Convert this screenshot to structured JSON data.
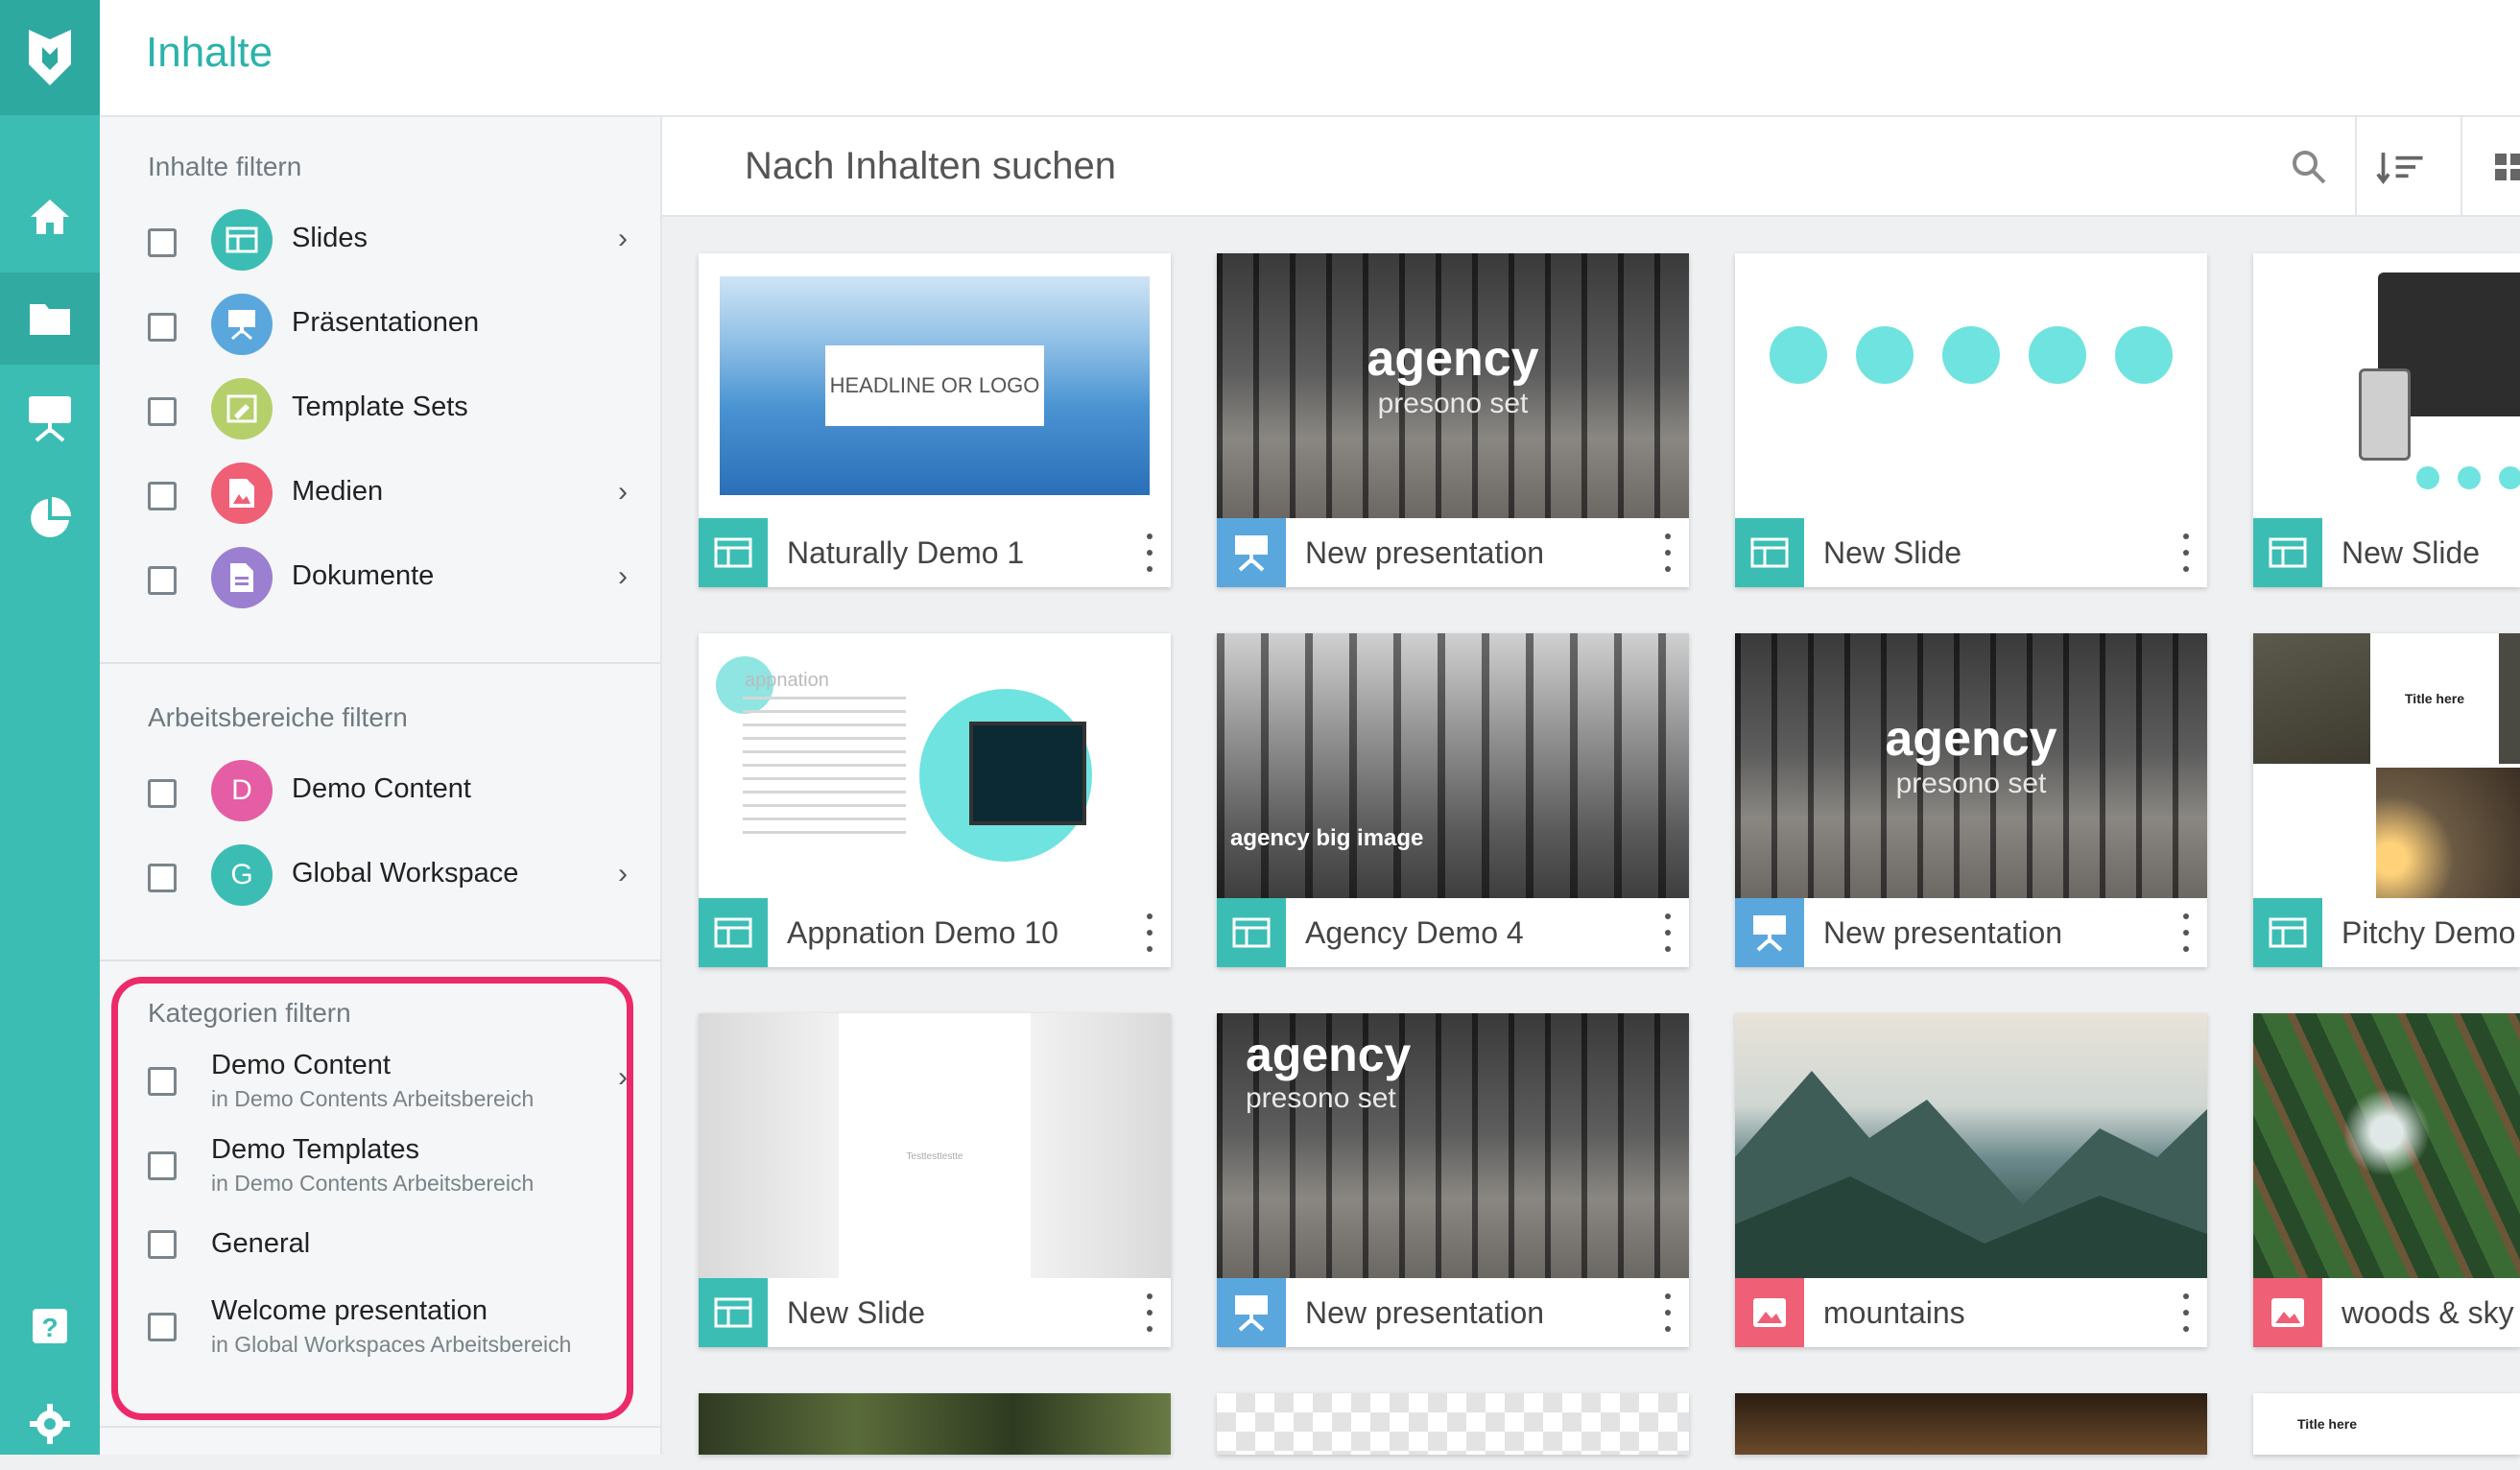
{
  "header": {
    "title": "Inhalte"
  },
  "rail": {
    "items": [
      {
        "icon": "home-icon"
      },
      {
        "icon": "folder-icon"
      },
      {
        "icon": "presentation-icon"
      },
      {
        "icon": "pie-chart-icon"
      }
    ],
    "bottom": [
      {
        "icon": "help-icon"
      },
      {
        "icon": "gear-icon"
      }
    ]
  },
  "filters": {
    "content_title": "Inhalte filtern",
    "content_items": [
      {
        "label": "Slides",
        "icon": "slide-icon",
        "color": "#3bbdb4"
      },
      {
        "label": "Präsentationen",
        "icon": "presentation-icon",
        "color": "#5aa7de"
      },
      {
        "label": "Template Sets",
        "icon": "template-icon",
        "color": "#b5cf6b"
      },
      {
        "label": "Medien",
        "icon": "image-icon",
        "color": "#ef5f76"
      },
      {
        "label": "Dokumente",
        "icon": "document-icon",
        "color": "#9b7fd0"
      }
    ],
    "workspace_title": "Arbeitsbereiche filtern",
    "workspace_items": [
      {
        "label": "Demo Content",
        "initial": "D",
        "color": "#e55da4"
      },
      {
        "label": "Global Workspace",
        "initial": "G",
        "color": "#3bbdb4"
      }
    ],
    "category_title": "Kategorien filtern",
    "category_items": [
      {
        "label": "Demo Content",
        "sub": "in Demo Contents Arbeitsbereich"
      },
      {
        "label": "Demo Templates",
        "sub": "in Demo Contents Arbeitsbereich"
      },
      {
        "label": "General",
        "sub": ""
      },
      {
        "label": "Welcome presentation",
        "sub": "in Global Workspaces Arbeitsbereich"
      }
    ]
  },
  "search": {
    "placeholder": "Nach Inhalten suchen"
  },
  "cards": [
    {
      "title": "Naturally Demo 1",
      "type": "slide",
      "thumb_text": "HEADLINE OR LOGO"
    },
    {
      "title": "New presentation",
      "type": "presentation",
      "thumb_title": "agency",
      "thumb_sub": "presono set"
    },
    {
      "title": "New Slide",
      "type": "slide"
    },
    {
      "title": "New Slide",
      "type": "slide"
    },
    {
      "title": "Appnation Demo 10",
      "type": "slide",
      "thumb_text": "appnation"
    },
    {
      "title": "Agency Demo 4",
      "type": "slide",
      "thumb_text": "agency big image"
    },
    {
      "title": "New presentation",
      "type": "presentation",
      "thumb_title": "agency",
      "thumb_sub": "presono set"
    },
    {
      "title": "Pitchy Demo",
      "type": "slide",
      "thumb_text": "Title here"
    },
    {
      "title": "New Slide",
      "type": "slide",
      "thumb_text": "Testtesttestte"
    },
    {
      "title": "New presentation",
      "type": "presentation",
      "thumb_title": "agency",
      "thumb_sub": "presono set"
    },
    {
      "title": "mountains",
      "type": "media"
    },
    {
      "title": "woods & sky",
      "type": "media"
    }
  ],
  "colors": {
    "teal": "#3bbdb4",
    "blue": "#5aa7de",
    "pink": "#ef5f76",
    "highlight": "#ec2a6a"
  }
}
